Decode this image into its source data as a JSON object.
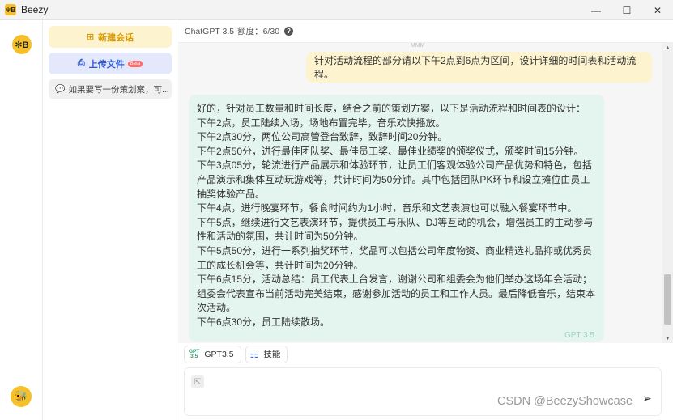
{
  "window": {
    "title": "Beezy",
    "logo_text": "✻B",
    "controls": {
      "minimize": "—",
      "maximize": "☐",
      "close": "✕"
    }
  },
  "rail": {
    "logo_text": "✻B",
    "bee_glyph": "🐝"
  },
  "sessions": {
    "new_chat_label": "新建会话",
    "new_chat_icon": "⊞",
    "upload_label": "上传文件",
    "upload_icon": "⎙",
    "beta_label": "Beta",
    "items": [
      {
        "label": "如果要写一份策划案，可...",
        "icon": "💬"
      }
    ]
  },
  "topbar": {
    "model": "ChatGPT 3.5",
    "quota_label": "额度：",
    "quota": "6/30",
    "help_icon": "?"
  },
  "chat": {
    "faded_text": "MMM",
    "user_message": "针对活动流程的部分请以下午2点到6点为区间，设计详细的时间表和活动流程。",
    "bot_lines": [
      "好的，针对员工数量和时间长度，结合之前的策划方案，以下是活动流程和时间表的设计：",
      "下午2点，员工陆续入场，场地布置完毕，音乐欢快播放。",
      "下午2点30分，两位公司高管登台致辞，致辞时间20分钟。",
      "下午2点50分，进行最佳团队奖、最佳员工奖、最佳业绩奖的颁奖仪式，颁奖时间15分钟。",
      "下午3点05分，轮流进行产品展示和体验环节，让员工们客观体验公司产品优势和特色，包括产品演示和集体互动玩游戏等，共计时间为50分钟。其中包括团队PK环节和设立摊位由员工抽奖体验产品。",
      "下午4点，进行晚宴环节，餐食时间约为1小时，音乐和文艺表演也可以融入餐宴环节中。",
      "下午5点，继续进行文艺表演环节，提供员工与乐队、DJ等互动的机会，增强员工的主动参与性和活动的氛围，共计时间为50分钟。",
      "下午5点50分，进行一系列抽奖环节，奖品可以包括公司年度物资、商业精选礼品抑或优秀员工的成长机会等，共计时间为20分钟。",
      "下午6点15分，活动总结：员工代表上台发言，谢谢公司和组委会为他们举办这场年会活动；组委会代表宣布当前活动完美结束，感谢参加活动的员工和工作人员。最后降低音乐，结束本次活动。",
      "下午6点30分，员工陆续散场。"
    ],
    "bot_model_tag": "GPT 3.5"
  },
  "scrollbar": {
    "up": "▲",
    "down": "▼"
  },
  "toolbar": {
    "gpt_button_label": "GPT3.5",
    "gpt_icon_top": "GPT",
    "gpt_icon_bottom": "3.5",
    "skills_button_label": "技能",
    "skills_icon": "⚏"
  },
  "input": {
    "attach_icon": "⇱",
    "send_icon": "➢"
  },
  "watermark": "CSDN @BeezyShowcase"
}
